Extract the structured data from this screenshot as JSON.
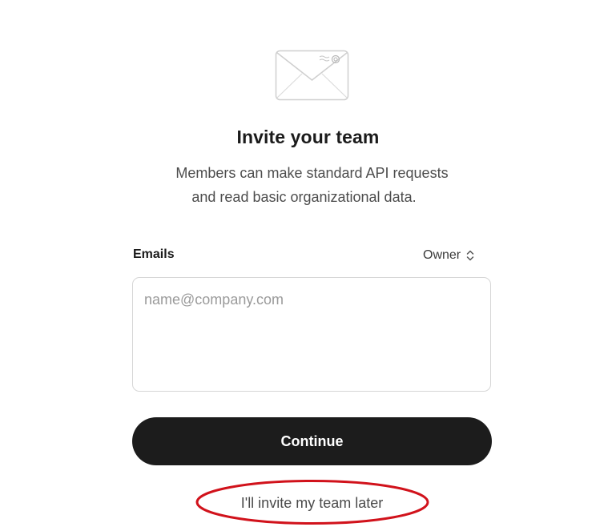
{
  "header": {
    "icon": "envelope-icon",
    "title": "Invite your team",
    "subtitle_line1": "Members can make standard API requests",
    "subtitle_line2": "and read basic organizational data."
  },
  "form": {
    "emails_label": "Emails",
    "role": {
      "selected": "Owner",
      "icon": "chevron-up-down-icon"
    },
    "emails_input": {
      "value": "",
      "placeholder": "name@company.com"
    },
    "continue_label": "Continue",
    "skip_label": "I'll invite my team later"
  },
  "annotation": {
    "shape": "ellipse",
    "target": "skip-invite-link",
    "color": "#d1121b"
  },
  "colors": {
    "button_bg": "#1c1c1c",
    "button_text": "#ffffff",
    "border": "#d6d6d6"
  }
}
